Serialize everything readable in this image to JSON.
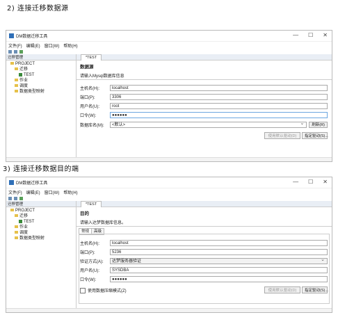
{
  "section2": {
    "heading": "2) 连接迁移数据源",
    "window": {
      "title": "DM数据迁移工具",
      "controls": [
        "—",
        "☐",
        "✕"
      ],
      "menu": [
        "文件(F)",
        "编辑(E)",
        "窗口(W)",
        "帮助(H)"
      ],
      "left_pane_title": "迁移管理",
      "tree": [
        "PROJECT",
        "迁移",
        "TEST",
        "作业",
        "调度",
        "数据类型映射"
      ],
      "tab": "*TEST",
      "wizard_title": "数据源",
      "wizard_desc": "请输入Mysql数据库信息",
      "fields": [
        {
          "label": "主机名(H):",
          "value": "localhost"
        },
        {
          "label": "端口(P):",
          "value": "3306"
        },
        {
          "label": "用户名(U):",
          "value": "root"
        },
        {
          "label": "口令(W):",
          "value": "●●●●●●"
        },
        {
          "label": "数据库名(M):",
          "value": "<默认>"
        }
      ],
      "refresh_button": "刷新(R)",
      "default_driver_button": "使用默认驱动(D)",
      "specify_driver_button": "指定驱动(S)..."
    }
  },
  "section3": {
    "heading": "3) 连接迁移数据目的端",
    "window": {
      "title": "DM数据迁移工具",
      "controls": [
        "—",
        "☐",
        "✕"
      ],
      "menu": [
        "文件(F)",
        "编辑(E)",
        "窗口(W)",
        "帮助(H)"
      ],
      "left_pane_title": "迁移管理",
      "tree": [
        "PROJECT",
        "迁移",
        "TEST",
        "作业",
        "调度",
        "数据类型映射"
      ],
      "tab": "*TEST",
      "wizard_title": "目的",
      "wizard_desc": "请输入达梦数据库信息。",
      "subtabs": [
        "常规",
        "高级"
      ],
      "fields": [
        {
          "label": "主机名(H):",
          "value": "localhost"
        },
        {
          "label": "端口(P):",
          "value": "5236"
        },
        {
          "label": "验证方式(A):",
          "value": "达梦服务器验证"
        },
        {
          "label": "用户名(U):",
          "value": "SYSDBA"
        },
        {
          "label": "口令(W):",
          "value": "●●●●●●"
        }
      ],
      "compress_checkbox": "使用数据压缩模式(Z)",
      "default_driver_button": "使用默认驱动(D)",
      "specify_driver_button": "指定驱动(S)..."
    }
  }
}
